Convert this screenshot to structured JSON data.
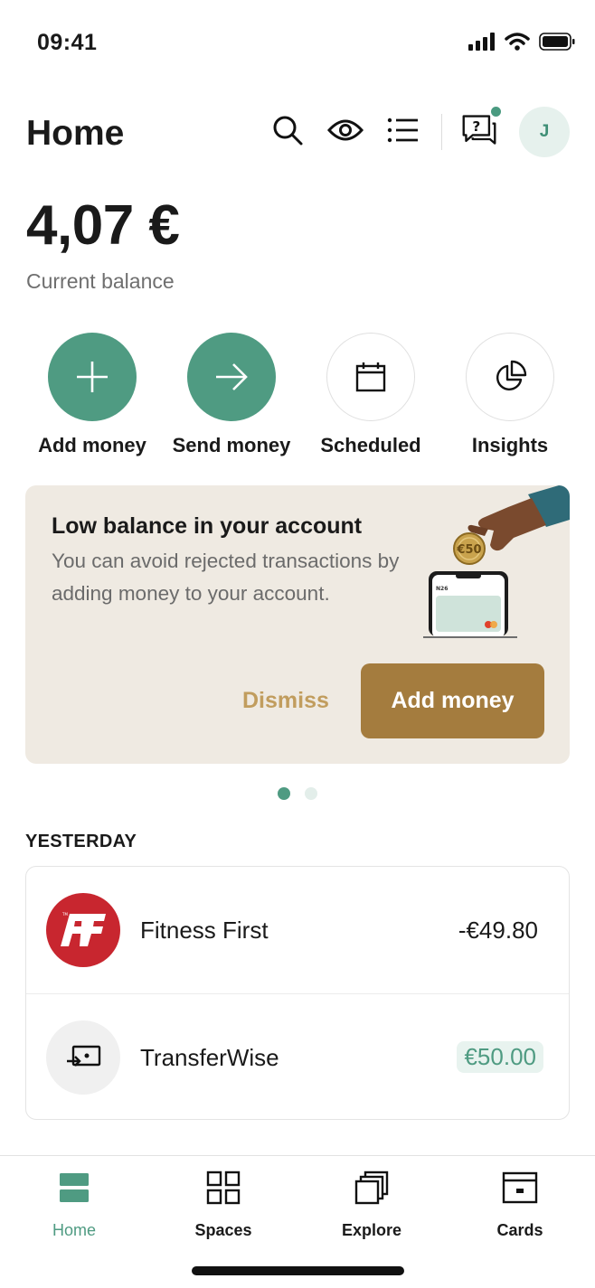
{
  "status_bar": {
    "time": "09:41",
    "icons": [
      "signal-icon",
      "wifi-icon",
      "battery-icon"
    ]
  },
  "header": {
    "title": "Home",
    "icons": [
      "search-icon",
      "eye-icon",
      "list-icon",
      "support-chat-icon"
    ],
    "avatar_initial": "J"
  },
  "balance": {
    "amount": "4,07 €",
    "label": "Current balance"
  },
  "actions": [
    {
      "label": "Add money",
      "icon": "plus-icon"
    },
    {
      "label": "Send money",
      "icon": "arrow-right-icon"
    },
    {
      "label": "Scheduled",
      "icon": "calendar-icon"
    },
    {
      "label": "Insights",
      "icon": "pie-chart-icon"
    }
  ],
  "promo": {
    "title": "Low balance in your account",
    "body": "You can avoid rejected transactions by adding money to your account.",
    "illustration_coin": "€50",
    "illustration_phone_brand": "N26",
    "dismiss_label": "Dismiss",
    "primary_label": "Add money",
    "pager_total": 2,
    "pager_active": 1
  },
  "transactions": {
    "section_header": "YESTERDAY",
    "items": [
      {
        "name": "Fitness First",
        "amount": "-€49.80",
        "logo": "fitness-first-logo"
      },
      {
        "name": "TransferWise",
        "amount": "€50.00",
        "logo": "transfer-icon"
      }
    ]
  },
  "tab_bar": {
    "tabs": [
      {
        "label": "Home",
        "icon": "home-icon",
        "active": true
      },
      {
        "label": "Spaces",
        "icon": "spaces-grid-icon",
        "active": false
      },
      {
        "label": "Explore",
        "icon": "explore-icon",
        "active": false
      },
      {
        "label": "Cards",
        "icon": "cards-icon",
        "active": false
      }
    ]
  },
  "colors": {
    "brand_green": "#4f9b82",
    "promo_background": "#efeae2",
    "promo_button": "#a47c3e",
    "dismiss_text": "#c19d5e",
    "fitness_red": "#c8262f"
  }
}
